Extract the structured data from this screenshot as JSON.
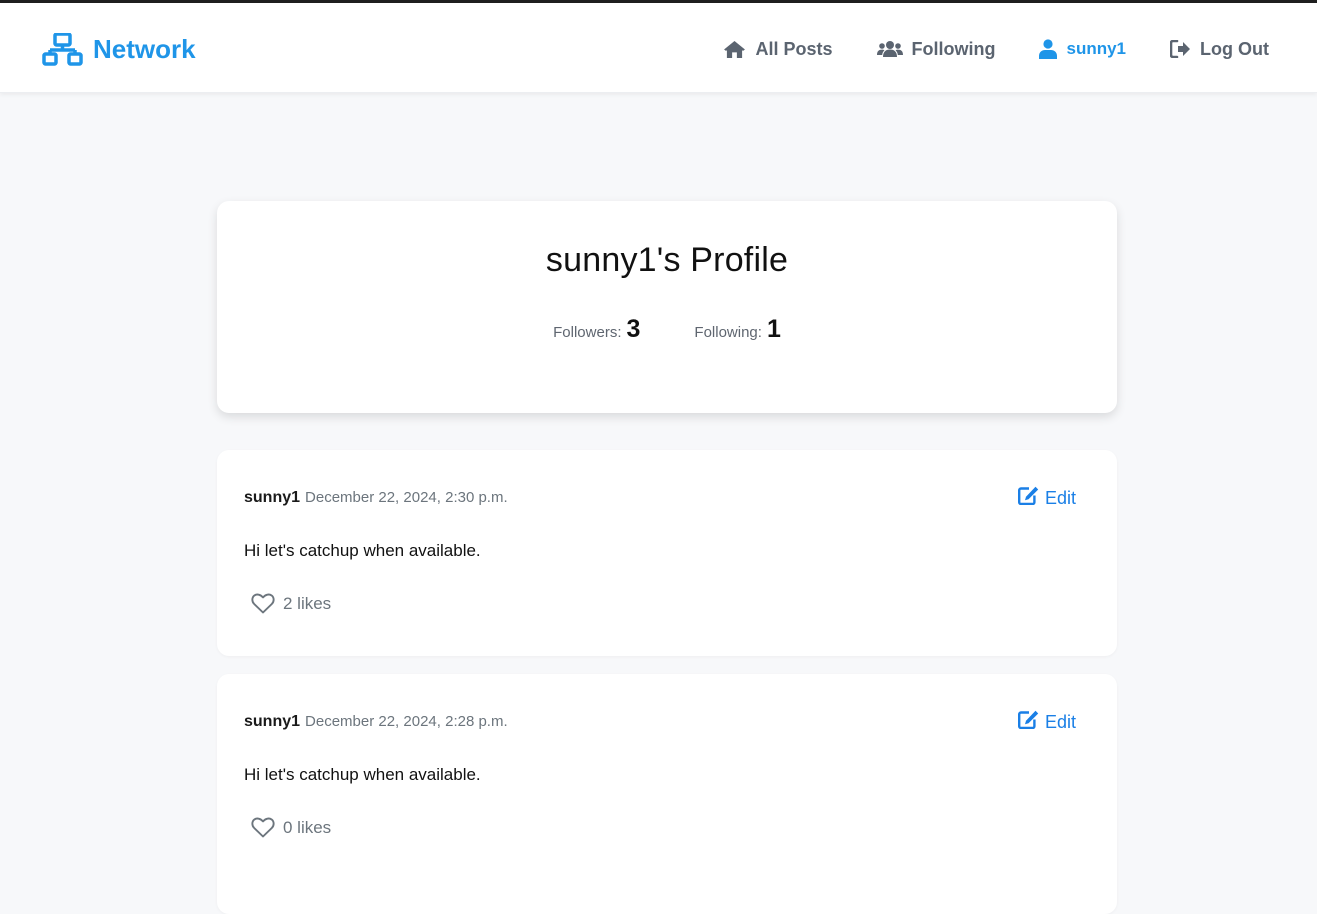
{
  "brand": {
    "name": "Network",
    "icon": "network-icon",
    "color": "#1f95e8"
  },
  "nav": {
    "items": [
      {
        "label": "All Posts",
        "icon": "home-icon"
      },
      {
        "label": "Following",
        "icon": "users-icon"
      },
      {
        "label": "sunny1",
        "icon": "user-icon",
        "active": true
      },
      {
        "label": "Log Out",
        "icon": "sign-out-icon"
      }
    ]
  },
  "profile": {
    "title": "sunny1's Profile",
    "followers_label": "Followers:",
    "followers_count": "3",
    "following_label": "Following:",
    "following_count": "1"
  },
  "posts": [
    {
      "author": "sunny1",
      "timestamp": "December 22, 2024, 2:30 p.m.",
      "edit_label": "Edit",
      "content": "Hi let's catchup when available.",
      "likes": "2 likes"
    },
    {
      "author": "sunny1",
      "timestamp": "December 22, 2024, 2:28 p.m.",
      "edit_label": "Edit",
      "content": "Hi let's catchup when available.",
      "likes": "0 likes"
    }
  ],
  "colors": {
    "accent": "#1f95e8",
    "edit": "#1a7fe6",
    "muted": "#6c757d",
    "background": "#f7f8fa"
  }
}
